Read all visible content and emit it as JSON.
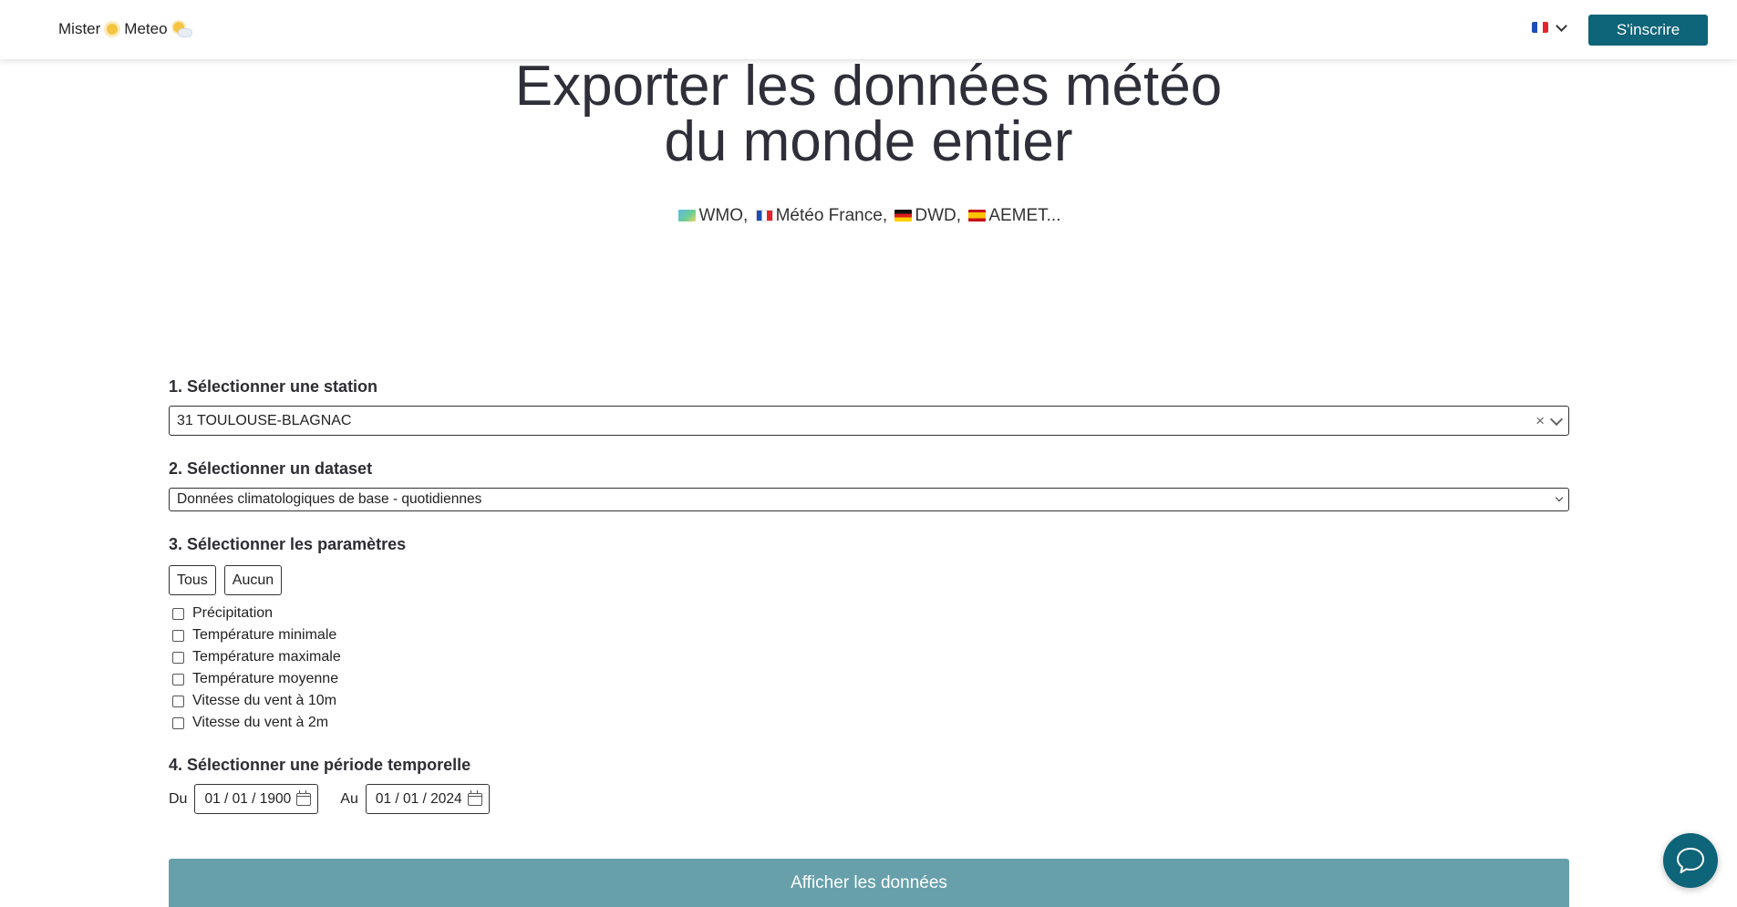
{
  "header": {
    "brand_left": "Mister",
    "brand_right": "Meteo",
    "language_flag_icon": "flag-fr-icon",
    "signup_label": "S'inscrire"
  },
  "hero": {
    "title_line1": "Exporter les données météo",
    "title_line2": "du monde entier",
    "sources": [
      {
        "icon": "wmo-map-icon",
        "label": "WMO,"
      },
      {
        "icon": "flag-fr-icon",
        "label": "Météo France,"
      },
      {
        "icon": "flag-de-icon",
        "label": "DWD,"
      },
      {
        "icon": "flag-es-icon",
        "label": "AEMET..."
      }
    ]
  },
  "form": {
    "station_label": "1. Sélectionner une station",
    "station_value": "31 TOULOUSE-BLAGNAC",
    "station_clear": "×",
    "dataset_label": "2. Sélectionner un dataset",
    "dataset_value": "Données climatologiques de base - quotidiennes",
    "params_label": "3. Sélectionner les paramètres",
    "all_label": "Tous",
    "none_label": "Aucun",
    "params": [
      "Précipitation",
      "Température minimale",
      "Température maximale",
      "Température moyenne",
      "Vitesse du vent à 10m",
      "Vitesse du vent à 2m"
    ],
    "period_label": "4. Sélectionner une période temporelle",
    "from_label": "Du",
    "from_value": "01 / 01 / 1900",
    "to_label": "Au",
    "to_value": "01 / 01 / 2024",
    "submit_label": "Afficher les données"
  },
  "colors": {
    "primary": "#0e6478",
    "submit": "#67a0ab"
  }
}
